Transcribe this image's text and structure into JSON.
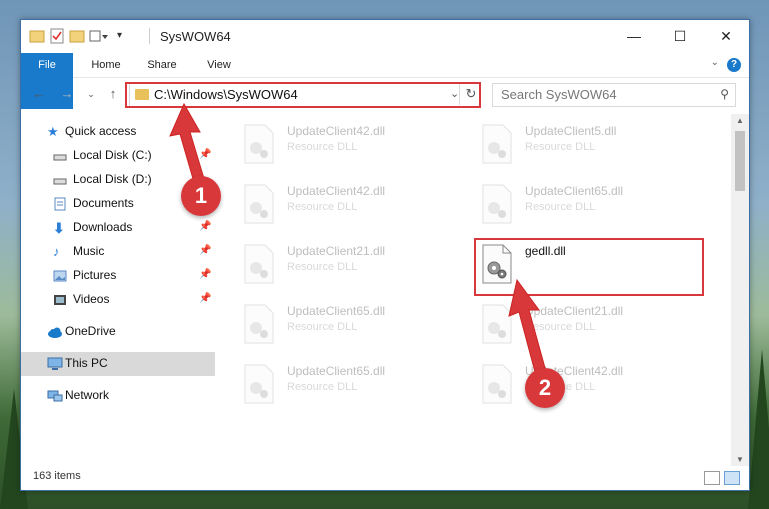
{
  "window": {
    "title": "SysWOW64"
  },
  "window_controls": {
    "minimize": "—",
    "maximize": "☐",
    "close": "✕"
  },
  "ribbon": {
    "tabs": [
      "File",
      "Home",
      "Share",
      "View"
    ],
    "help": "?"
  },
  "address": {
    "path": "C:\\Windows\\SysWOW64"
  },
  "search": {
    "placeholder": "Search SysWOW64"
  },
  "sidebar": {
    "items": [
      {
        "label": "Quick access",
        "icon": "star-icon"
      },
      {
        "label": "Local Disk (C:)",
        "icon": "drive-icon"
      },
      {
        "label": "Local Disk (D:)",
        "icon": "drive-icon"
      },
      {
        "label": "Documents",
        "icon": "documents-icon"
      },
      {
        "label": "Downloads",
        "icon": "downloads-icon"
      },
      {
        "label": "Music",
        "icon": "music-icon"
      },
      {
        "label": "Pictures",
        "icon": "pictures-icon"
      },
      {
        "label": "Videos",
        "icon": "videos-icon"
      },
      {
        "label": "OneDrive",
        "icon": "cloud-icon"
      },
      {
        "label": "This PC",
        "icon": "computer-icon"
      },
      {
        "label": "Network",
        "icon": "network-icon"
      }
    ]
  },
  "files": [
    {
      "name": "UpdateClient42.dll",
      "type": "Resource DLL"
    },
    {
      "name": "UpdateClient5.dll",
      "type": "Resource DLL"
    },
    {
      "name": "UpdateClient42.dll",
      "type": "Resource DLL"
    },
    {
      "name": "UpdateClient65.dll",
      "type": "Resource DLL"
    },
    {
      "name": "UpdateClient21.dll",
      "type": "Resource DLL"
    },
    {
      "name": "gedll.dll",
      "type": ""
    },
    {
      "name": "UpdateClient65.dll",
      "type": "Resource DLL"
    },
    {
      "name": "UpdateClient21.dll",
      "type": "Resource DLL"
    },
    {
      "name": "UpdateClient65.dll",
      "type": "Resource DLL"
    },
    {
      "name": "UpdateClient42.dll",
      "type": "Resource DLL"
    }
  ],
  "status": {
    "count": "163 items"
  },
  "annotations": {
    "step1": "1",
    "step2": "2",
    "color": "#d9383a"
  }
}
